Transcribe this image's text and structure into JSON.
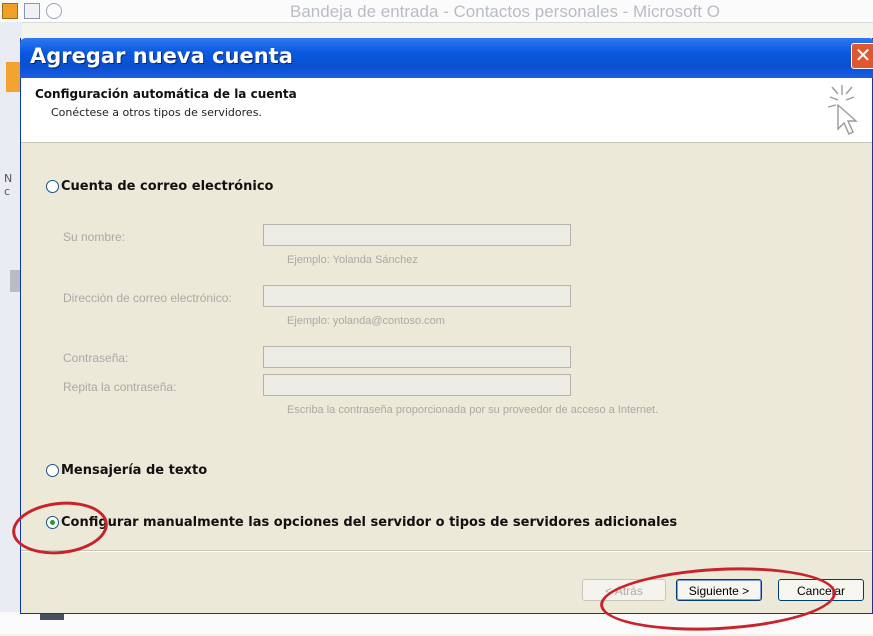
{
  "background": {
    "window_title": "Bandeja de entrada - Contactos personales - Microsoft O",
    "left_letters": [
      "N",
      "c"
    ]
  },
  "dialog": {
    "title": "Agregar nueva cuenta",
    "close_glyph": "✕",
    "header": {
      "title": "Configuración automática de la cuenta",
      "subtitle": "Conéctese a otros tipos de servidores."
    },
    "options": {
      "email": {
        "label": "Cuenta de correo electrónico",
        "checked": false
      },
      "sms": {
        "label": "Mensajería de texto",
        "checked": false
      },
      "manual": {
        "label": "Configurar manualmente las opciones del servidor o tipos de servidores adicionales",
        "checked": true
      }
    },
    "fields": {
      "name": {
        "label": "Su nombre:",
        "value": "",
        "hint": "Ejemplo: Yolanda Sánchez"
      },
      "email": {
        "label": "Dirección de correo electrónico:",
        "value": "",
        "hint": "Ejemplo: yolanda@contoso.com"
      },
      "password": {
        "label": "Contraseña:",
        "value": ""
      },
      "password_repeat": {
        "label": "Repita la contraseña:",
        "value": "",
        "hint": "Escriba la contraseña proporcionada por su proveedor de acceso a Internet."
      }
    },
    "buttons": {
      "back": "< Atrás",
      "next": "Siguiente >",
      "cancel": "Cancelar"
    }
  },
  "colors": {
    "titlebar": "#0a5ae0",
    "dialog_bg": "#ece9d8",
    "annotation": "#c8222b"
  }
}
